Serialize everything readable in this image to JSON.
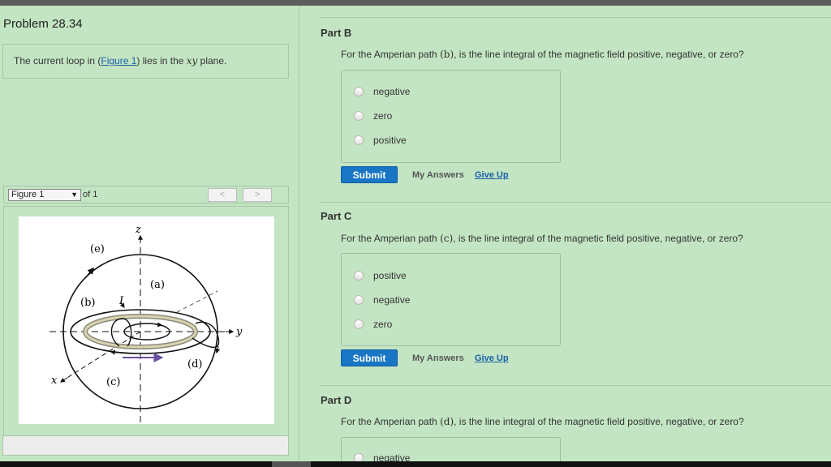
{
  "problem": {
    "title": "Problem 28.34",
    "intro_before": "The current loop in (",
    "intro_link": "Figure 1",
    "intro_middle": ") lies in the ",
    "intro_math": "xy",
    "intro_after": " plane."
  },
  "figure_nav": {
    "selected": "Figure 1",
    "of_label": "of 1",
    "prev": "<",
    "next": ">"
  },
  "figure": {
    "label_z": "z",
    "label_y": "y",
    "label_x": "x",
    "label_a": "(a)",
    "label_b": "(b)",
    "label_c": "(c)",
    "label_d": "(d)",
    "label_e": "(e)",
    "label_I": "I"
  },
  "parts": [
    {
      "title": "Part B",
      "q_before": "For the Amperian path ",
      "q_math": "(b)",
      "q_after": ", is the line integral of the magnetic field positive, negative, or zero?",
      "options": [
        "negative",
        "zero",
        "positive"
      ],
      "submit": "Submit",
      "my_answers": "My Answers",
      "give_up": "Give Up"
    },
    {
      "title": "Part C",
      "q_before": "For the Amperian path ",
      "q_math": "(c)",
      "q_after": ", is the line integral of the magnetic field positive, negative, or zero?",
      "options": [
        "positive",
        "negative",
        "zero"
      ],
      "submit": "Submit",
      "my_answers": "My Answers",
      "give_up": "Give Up"
    },
    {
      "title": "Part D",
      "q_before": "For the Amperian path ",
      "q_math": "(d)",
      "q_after": ", is the line integral of the magnetic field positive, negative, or zero?",
      "options": [
        "negative"
      ]
    }
  ],
  "colors": {
    "background": "#c3e5c3",
    "submit": "#1976c5",
    "link": "#1a5ea8",
    "current_arrow": "#6a4fa0"
  }
}
